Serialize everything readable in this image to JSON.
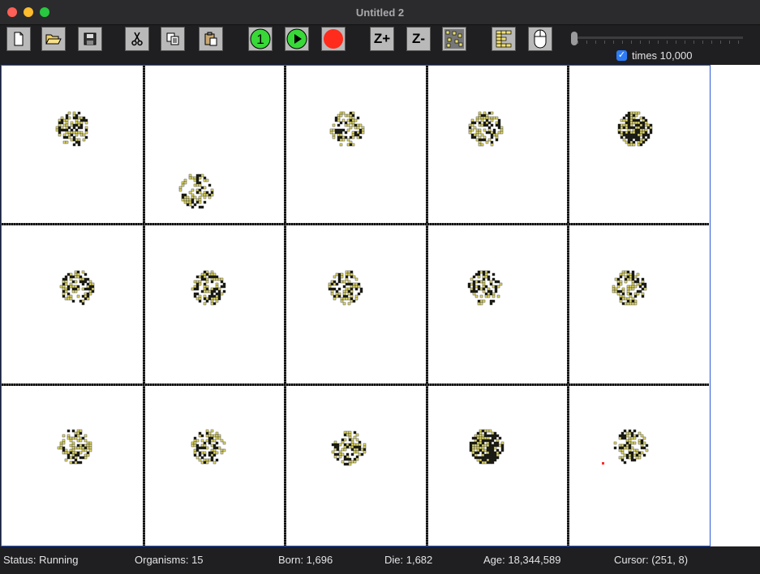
{
  "window": {
    "title": "Untitled 2"
  },
  "toolbar": {
    "buttons": [
      {
        "name": "new-file-button",
        "icon": "new-file-icon"
      },
      {
        "name": "open-file-button",
        "icon": "folder-open-icon"
      },
      {
        "name": "save-button",
        "icon": "floppy-disk-icon"
      },
      {
        "name": "cut-button",
        "icon": "scissors-icon"
      },
      {
        "name": "copy-button",
        "icon": "copy-icon"
      },
      {
        "name": "paste-button",
        "icon": "clipboard-icon"
      },
      {
        "name": "step-one-button",
        "icon": "step-one-icon",
        "label": "1"
      },
      {
        "name": "run-button",
        "icon": "play-icon"
      },
      {
        "name": "stop-button",
        "icon": "stop-icon"
      },
      {
        "name": "zoom-in-button",
        "icon": "zoom-in-icon",
        "label": "Z+"
      },
      {
        "name": "zoom-out-button",
        "icon": "zoom-out-icon",
        "label": "Z-"
      },
      {
        "name": "scatter-button",
        "icon": "scatter-grid-icon"
      },
      {
        "name": "edit-genome-button",
        "icon": "genome-grid-icon"
      },
      {
        "name": "mouse-mode-button",
        "icon": "mouse-icon"
      }
    ],
    "speed_slider": {
      "level": 0
    },
    "times_checkbox": {
      "checked": true,
      "label": "times 10,000"
    }
  },
  "colors": {
    "cell_fill": "#e8e070",
    "cell_dark": "#1a1a12",
    "grid_line": "#111111",
    "accent": "#2d7cf6"
  },
  "statusbar": {
    "status": "Status: Running",
    "organisms": "Organisms: 15",
    "born": "Born: 1,696",
    "die": "Die: 1,682",
    "age": "Age: 18,344,589",
    "cursor": "Cursor: (251, 8)"
  }
}
